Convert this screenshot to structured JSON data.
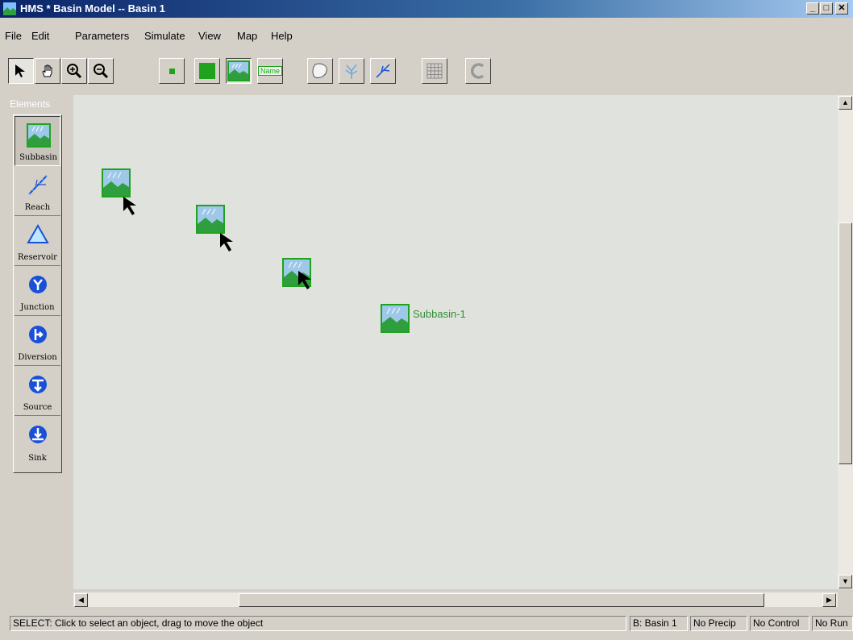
{
  "window": {
    "title": "HMS * Basin Model -- Basin 1",
    "buttons": [
      "_",
      "□",
      "✕"
    ]
  },
  "menu": [
    "File",
    "Edit",
    "Parameters",
    "Simulate",
    "View",
    "Map",
    "Help"
  ],
  "toolbar": {
    "tools": [
      "select-arrow-icon",
      "pan-hand-icon",
      "zoom-in-icon",
      "zoom-out-icon",
      "small-node-icon",
      "large-node-icon",
      "subbasin-icon",
      "name-label-icon",
      "boundary-icon",
      "stream-network-icon",
      "reach-icon",
      "grid-icon",
      "c-icon"
    ],
    "name_button": "Name"
  },
  "palette": {
    "title": "Elements",
    "items": [
      "Subbasin",
      "Reach",
      "Reservoir",
      "Junction",
      "Diversion",
      "Source",
      "Sink"
    ]
  },
  "canvas": {
    "nodes": [
      {
        "type": "subbasin",
        "label": ""
      },
      {
        "type": "subbasin",
        "label": ""
      },
      {
        "type": "subbasin",
        "label": ""
      },
      {
        "type": "subbasin",
        "label": "Subbasin-1"
      }
    ]
  },
  "status": {
    "message": "SELECT: Click to select an object, drag to move the object",
    "basin": "B: Basin 1",
    "precip": "No Precip",
    "control": "No Control",
    "run": "No Run"
  },
  "colors": {
    "titlebar": "#0a246a",
    "canvas": "#e0e2de",
    "node_label": "#2f8f2f",
    "element_blue": "#1a4fd8"
  }
}
